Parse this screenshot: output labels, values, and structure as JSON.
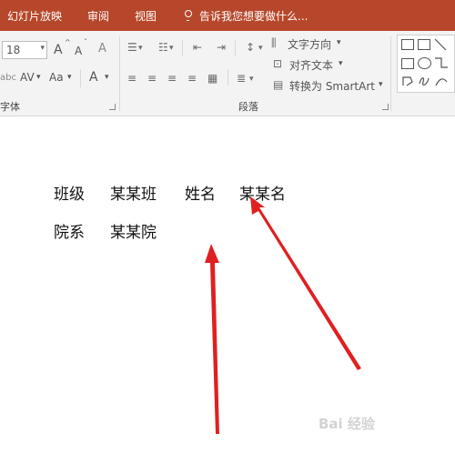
{
  "tabs": [
    {
      "label": "幻灯片放映"
    },
    {
      "label": "审阅"
    },
    {
      "label": "视图"
    }
  ],
  "tell_me": {
    "placeholder": "告诉我您想要做什么...",
    "icon": "lightbulb-icon"
  },
  "ribbon": {
    "font": {
      "size_value": "18",
      "group_label": "字体",
      "grow_label": "A",
      "shrink_label": "A",
      "clear_label": "A",
      "abc_label": "abc",
      "spacing_label": "AV",
      "case_label": "Aa",
      "color_label": "A"
    },
    "paragraph": {
      "group_label": "段落",
      "text_direction": "文字方向",
      "align_text": "对齐文本",
      "convert_smartart": "转换为 SmartArt"
    }
  },
  "document": {
    "row1": {
      "label1": "班级",
      "value1": "某某班",
      "label2": "姓名",
      "value2": "某某名"
    },
    "row2": {
      "label1": "院系",
      "value1": "某某院"
    }
  },
  "annotation": {
    "arrow_color": "#e02020"
  },
  "watermark": {
    "text": "Bai 经验"
  },
  "colors": {
    "tab_bar": "#b7472a",
    "ribbon_bg": "#f3f3f3"
  }
}
